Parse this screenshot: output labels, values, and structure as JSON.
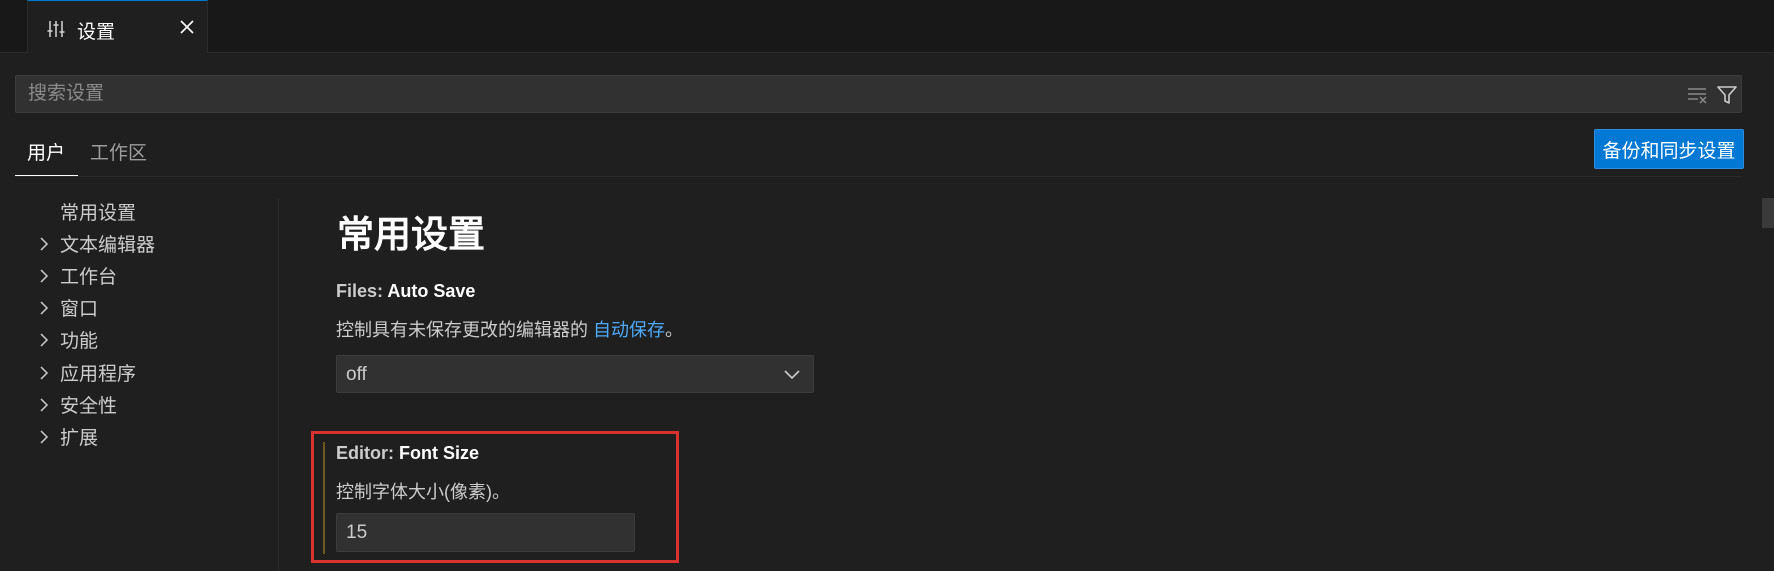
{
  "tab": {
    "label": "设置",
    "icon": "settings-sliders-icon",
    "close_icon": "close-icon"
  },
  "search": {
    "placeholder": "搜索设置",
    "value": "",
    "clear_icon": "clear-filter-icon",
    "filter_icon": "filter-icon"
  },
  "scope": {
    "user": "用户",
    "workspace": "工作区",
    "active": "user"
  },
  "sync_button": "备份和同步设置",
  "toc": {
    "items": [
      {
        "label": "常用设置",
        "expandable": false
      },
      {
        "label": "文本编辑器",
        "expandable": true
      },
      {
        "label": "工作台",
        "expandable": true
      },
      {
        "label": "窗口",
        "expandable": true
      },
      {
        "label": "功能",
        "expandable": true
      },
      {
        "label": "应用程序",
        "expandable": true
      },
      {
        "label": "安全性",
        "expandable": true
      },
      {
        "label": "扩展",
        "expandable": true
      }
    ]
  },
  "main": {
    "section_title": "常用设置",
    "auto_save": {
      "category": "Files: ",
      "name": "Auto Save",
      "desc_prefix": "控制具有未保存更改的编辑器的 ",
      "desc_link": "自动保存",
      "desc_suffix": "。",
      "value": "off"
    },
    "font_size": {
      "category": "Editor: ",
      "name": "Font Size",
      "desc": "控制字体大小(像素)。",
      "value": "15"
    }
  },
  "colors": {
    "accent": "#0078d4",
    "highlight_border": "#d9322f",
    "link": "#4daafc",
    "background": "#1f1f1f"
  }
}
